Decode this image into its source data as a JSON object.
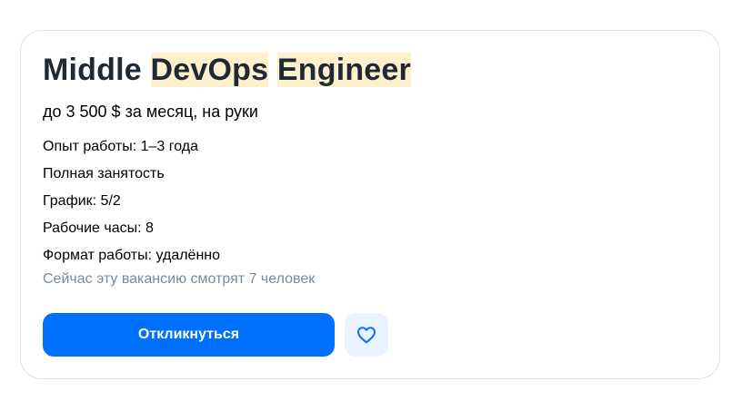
{
  "vacancy": {
    "title_part_1": "Middle ",
    "title_part_2": "DevOps",
    "title_part_3": " ",
    "title_part_4": "Engineer",
    "salary": "до 3 500 $ за месяц, на руки",
    "details": [
      "Опыт работы: 1–3 года",
      "Полная занятость",
      "График: 5/2",
      "Рабочие часы: 8",
      "Формат работы: удалённо"
    ],
    "viewers": "Сейчас эту вакансию смотрят 7 человек"
  },
  "actions": {
    "apply_label": "Откликнуться",
    "favorite_icon": "heart-icon"
  },
  "colors": {
    "accent": "#0070ff",
    "highlight": "#fdf0cc",
    "muted_text": "#7a8a99",
    "favorite_bg": "#eaf3ff"
  }
}
